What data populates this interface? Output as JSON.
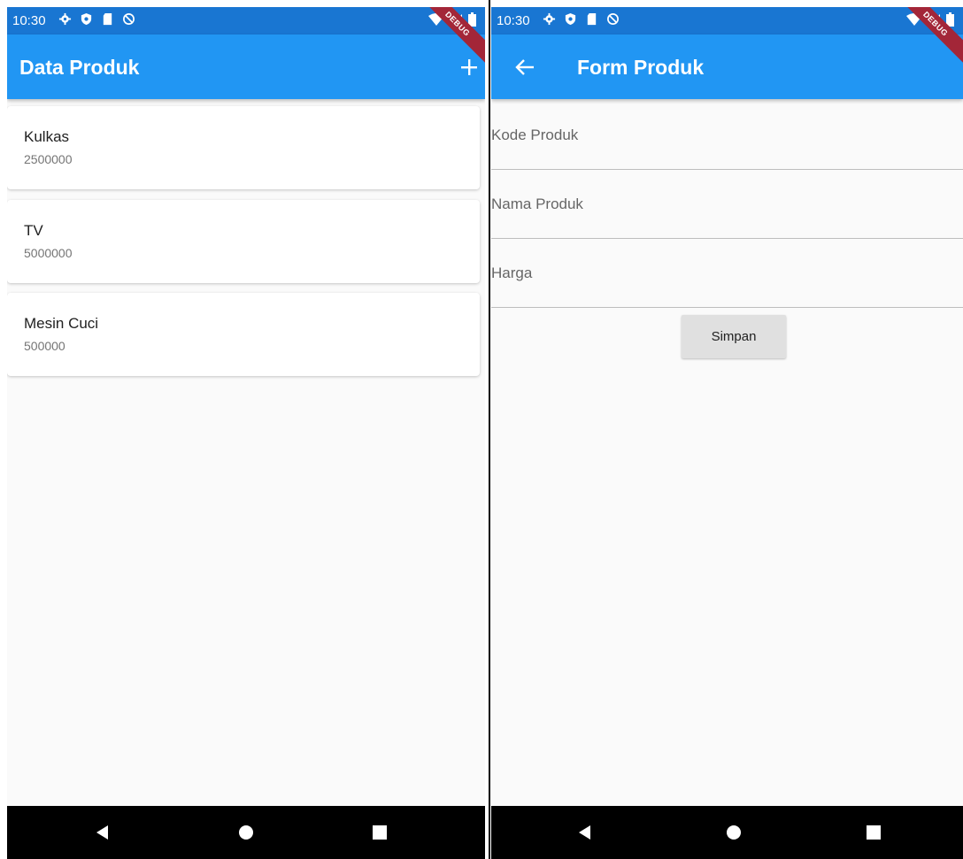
{
  "colors": {
    "primary": "#2196f3",
    "primary_dark": "#1976d2",
    "debug": "#a32638",
    "button": "#e0e0e0"
  },
  "status_bar": {
    "time": "10:30",
    "left_icons": [
      "settings-icon",
      "shield-icon",
      "sd-card-icon",
      "sync-disabled-icon"
    ],
    "right_icons": [
      "wifi-icon",
      "signal-icon",
      "battery-icon"
    ]
  },
  "debug_banner": "DEBUG",
  "list_screen": {
    "title": "Data Produk",
    "add_icon": "plus-icon",
    "items": [
      {
        "name": "Kulkas",
        "price": "2500000"
      },
      {
        "name": "TV",
        "price": "5000000"
      },
      {
        "name": "Mesin Cuci",
        "price": "500000"
      }
    ]
  },
  "form_screen": {
    "title": "Form Produk",
    "back_icon": "arrow-back-icon",
    "fields": [
      {
        "placeholder": "Kode Produk",
        "value": ""
      },
      {
        "placeholder": "Nama Produk",
        "value": ""
      },
      {
        "placeholder": "Harga",
        "value": ""
      }
    ],
    "save_label": "Simpan"
  },
  "nav_bar": {
    "buttons": [
      "back-triangle-icon",
      "home-circle-icon",
      "recents-square-icon"
    ]
  }
}
